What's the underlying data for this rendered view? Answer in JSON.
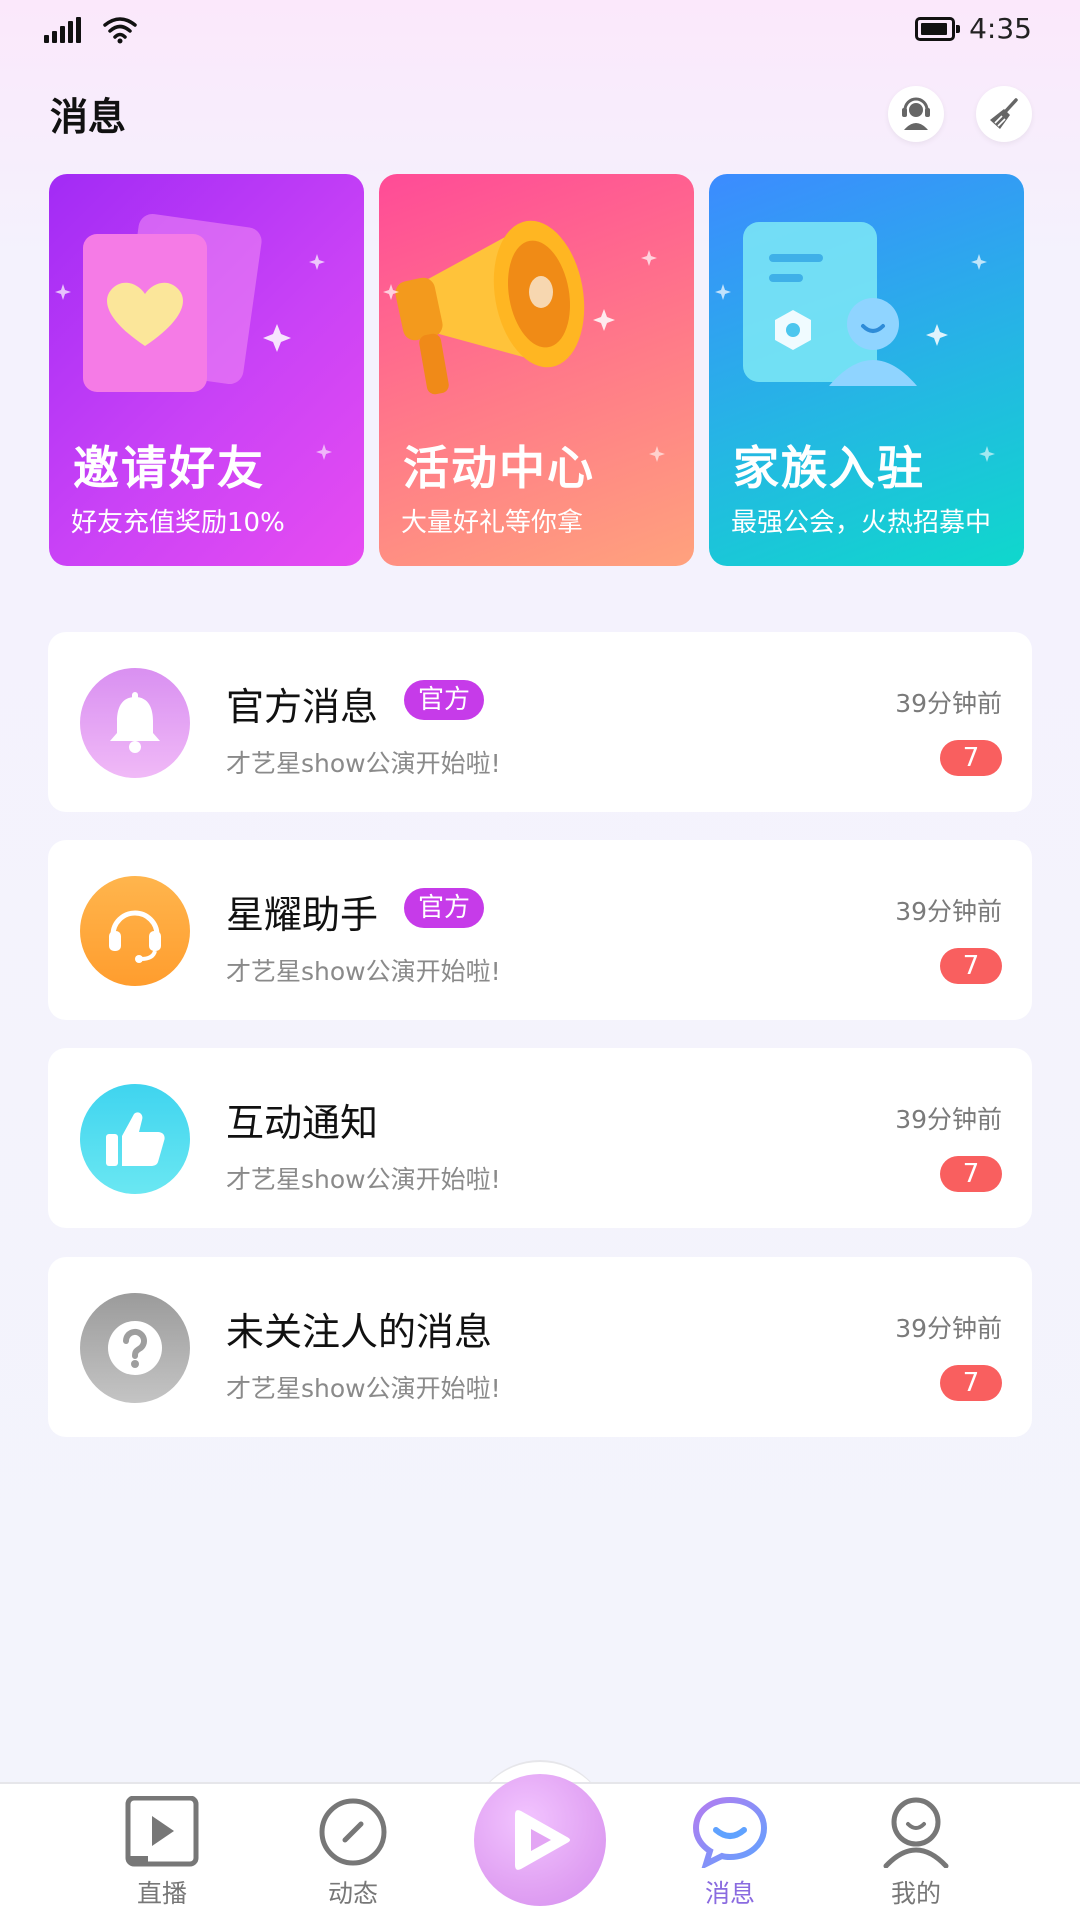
{
  "status_bar": {
    "time": "4:35"
  },
  "header": {
    "title": "消息",
    "support_icon": "headset-user-icon",
    "clean_icon": "broom-icon"
  },
  "banners": [
    {
      "title": "邀请好友",
      "subtitle": "好友充值奖励10%",
      "icon": "heart-card-icon",
      "color_start": "#a92cf6",
      "color_end": "#e349f3"
    },
    {
      "title": "活动中心",
      "subtitle": "大量好礼等你拿",
      "icon": "megaphone-icon",
      "color_start": "#ff4f96",
      "color_end": "#ffa07a"
    },
    {
      "title": "家族入驻",
      "subtitle": "最强公会，火热招募中",
      "icon": "family-document-icon",
      "color_start": "#3b9cff",
      "color_end": "#10d3d3"
    }
  ],
  "messages": [
    {
      "name": "官方消息",
      "badge": "官方",
      "preview": "才艺星show公演开始啦!",
      "time": "39分钟前",
      "count": "7",
      "icon": "bell-icon",
      "color": "#e09af2"
    },
    {
      "name": "星耀助手",
      "badge": "官方",
      "preview": "才艺星show公演开始啦!",
      "time": "39分钟前",
      "count": "7",
      "icon": "headset-icon",
      "color": "#ffad42"
    },
    {
      "name": "互动通知",
      "badge": "",
      "preview": "才艺星show公演开始啦!",
      "time": "39分钟前",
      "count": "7",
      "icon": "thumbs-up-icon",
      "color": "#45dcef"
    },
    {
      "name": "未关注人的消息",
      "badge": "",
      "preview": "才艺星show公演开始啦!",
      "time": "39分钟前",
      "count": "7",
      "icon": "question-icon",
      "color": "#a9a9a9"
    }
  ],
  "nav": {
    "items": [
      {
        "label": "直播",
        "icon": "live-play-icon"
      },
      {
        "label": "动态",
        "icon": "compass-icon"
      },
      {
        "label": "消息",
        "icon": "chat-bubble-icon",
        "active": true
      },
      {
        "label": "我的",
        "icon": "profile-icon"
      }
    ],
    "center_icon": "play-center-icon",
    "active_color": "#8a6be0"
  }
}
